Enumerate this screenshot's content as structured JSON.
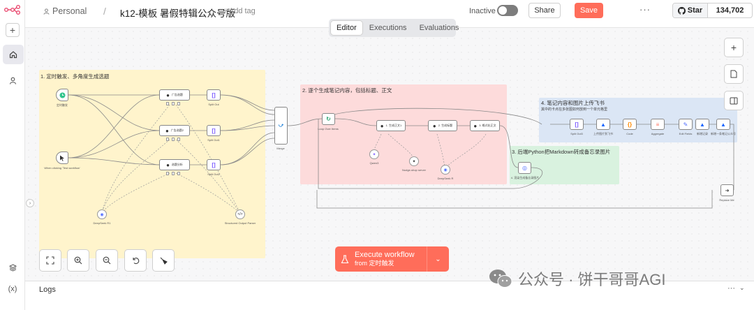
{
  "topbar": {
    "project": "Personal",
    "workflow_name": "k12-模板 暑假特辑公众号版",
    "add_tag": "+ Add tag",
    "inactive_label": "Inactive",
    "share_label": "Share",
    "save_label": "Save",
    "more_label": "···",
    "github_star_label": "Star",
    "github_star_count": "134,702"
  },
  "tabs": [
    {
      "label": "Editor",
      "active": true
    },
    {
      "label": "Executions",
      "active": false
    },
    {
      "label": "Evaluations",
      "active": false
    }
  ],
  "sticky_notes": {
    "note1_title": "1. 定时触发、多角度生成选题",
    "note2_title": "2. 逐个生成笔记内容，包括标题、正文",
    "note3_title": "3. 后端Python把Markdown转成备忘录图片",
    "note4_title": "4. 笔记内容和图片上传飞书",
    "note4_subtitle": "其中的卡点在多张图如何放到一个单元格里"
  },
  "nodes": {
    "schedule": "定时触发",
    "manual": "When clicking 'Test workflow'",
    "agent1": "广告选题",
    "agent2": "广告选题2",
    "agent3": "选题分析",
    "split1": "Split Out",
    "split2": "Split Out1",
    "split3": "Split Out2",
    "merge": "Merge",
    "deepseek": "DeepSeek R1",
    "parser": "Structured Output Parser",
    "loop": "Loop Over Items",
    "gen1": "1. 生成正文1",
    "gen2": "2. 生成标题",
    "gen3": "3. 格式化正文",
    "qwen": "Qwen3",
    "tool": "Nudge-shop server",
    "deepseek2": "DeepSeek R",
    "http": "4. 渲染生成备忘录图片",
    "f_split": "Split Out3",
    "f_upload": "上传图片到飞书",
    "f_code": "Code",
    "f_agg": "Aggregate",
    "f_edit": "Edit Fields",
    "f_sheet": "新增记录",
    "f_publish": "新增一条笔记公众号",
    "replace": "Replace Me"
  },
  "execute": {
    "label": "Execute workflow",
    "sub": "from 定时触发"
  },
  "watermark": "公众号 · 饼干哥哥AGI",
  "logs": {
    "label": "Logs"
  },
  "colors": {
    "accent": "#ff6d5a",
    "note_yellow": "#fff4cc",
    "note_red": "#fddbdb",
    "note_green": "#d9f2df",
    "note_blue": "#dbe6f5"
  }
}
